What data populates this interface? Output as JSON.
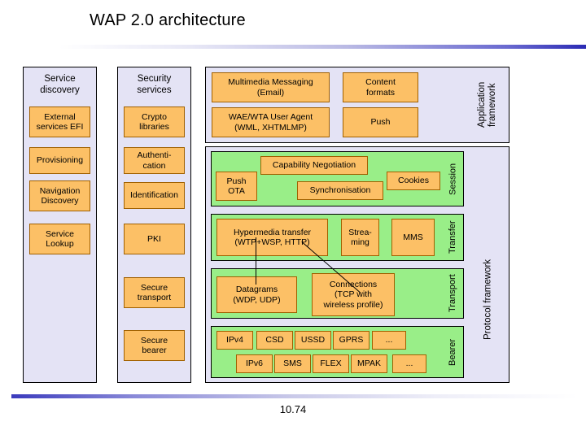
{
  "slide": {
    "title": "WAP 2.0 architecture",
    "footer_number": "10.74"
  },
  "colors": {
    "orange_fill": "#fcc066",
    "orange_border": "#a06000",
    "green_fill": "#99ee88",
    "lavender_fill": "#e4e3f5",
    "outline": "#000000",
    "accent_rule": "#2b2bb4"
  },
  "columns": {
    "service_discovery": {
      "heading": "Service\ndiscovery",
      "items": [
        {
          "label": "External\nservices EFI"
        },
        {
          "label": "Provisioning"
        },
        {
          "label": "Navigation\nDiscovery"
        },
        {
          "label": "Service\nLookup"
        }
      ]
    },
    "security_services": {
      "heading": "Security\nservices",
      "items": [
        {
          "label": "Crypto\nlibraries"
        },
        {
          "label": "Authenti-\ncation"
        },
        {
          "label": "Identification"
        },
        {
          "label": "PKI"
        },
        {
          "label": "Secure\ntransport"
        },
        {
          "label": "Secure\nbearer"
        }
      ]
    }
  },
  "application_framework": {
    "vertical_label": "Application\nframework",
    "items": [
      {
        "label": "Multimedia Messaging\n(Email)"
      },
      {
        "label": "Content\nformats"
      },
      {
        "label": "WAE/WTA User Agent\n(WML, XHTMLMP)"
      },
      {
        "label": "Push"
      }
    ]
  },
  "protocol_framework": {
    "vertical_label": "Protocol framework",
    "layers": [
      {
        "name": "session",
        "vertical_label": "Session",
        "items": [
          {
            "label": "Push\nOTA"
          },
          {
            "label": "Capability Negotiation"
          },
          {
            "label": "Synchronisation"
          },
          {
            "label": "Cookies"
          }
        ]
      },
      {
        "name": "transfer",
        "vertical_label": "Transfer",
        "items": [
          {
            "label": "Hypermedia transfer\n(WTP+WSP, HTTP)"
          },
          {
            "label": "Strea-\nming"
          },
          {
            "label": "MMS"
          }
        ]
      },
      {
        "name": "transport",
        "vertical_label": "Transport",
        "items": [
          {
            "label": "Datagrams\n(WDP, UDP)"
          },
          {
            "label": "Connections\n(TCP with\nwireless profile)"
          }
        ]
      },
      {
        "name": "bearer",
        "vertical_label": "Bearer",
        "row1": [
          {
            "label": "IPv4"
          },
          {
            "label": "CSD"
          },
          {
            "label": "USSD"
          },
          {
            "label": "GPRS"
          },
          {
            "label": "..."
          }
        ],
        "row2": [
          {
            "label": "IPv6"
          },
          {
            "label": "SMS"
          },
          {
            "label": "FLEX"
          },
          {
            "label": "MPAK"
          },
          {
            "label": "..."
          }
        ]
      }
    ]
  }
}
